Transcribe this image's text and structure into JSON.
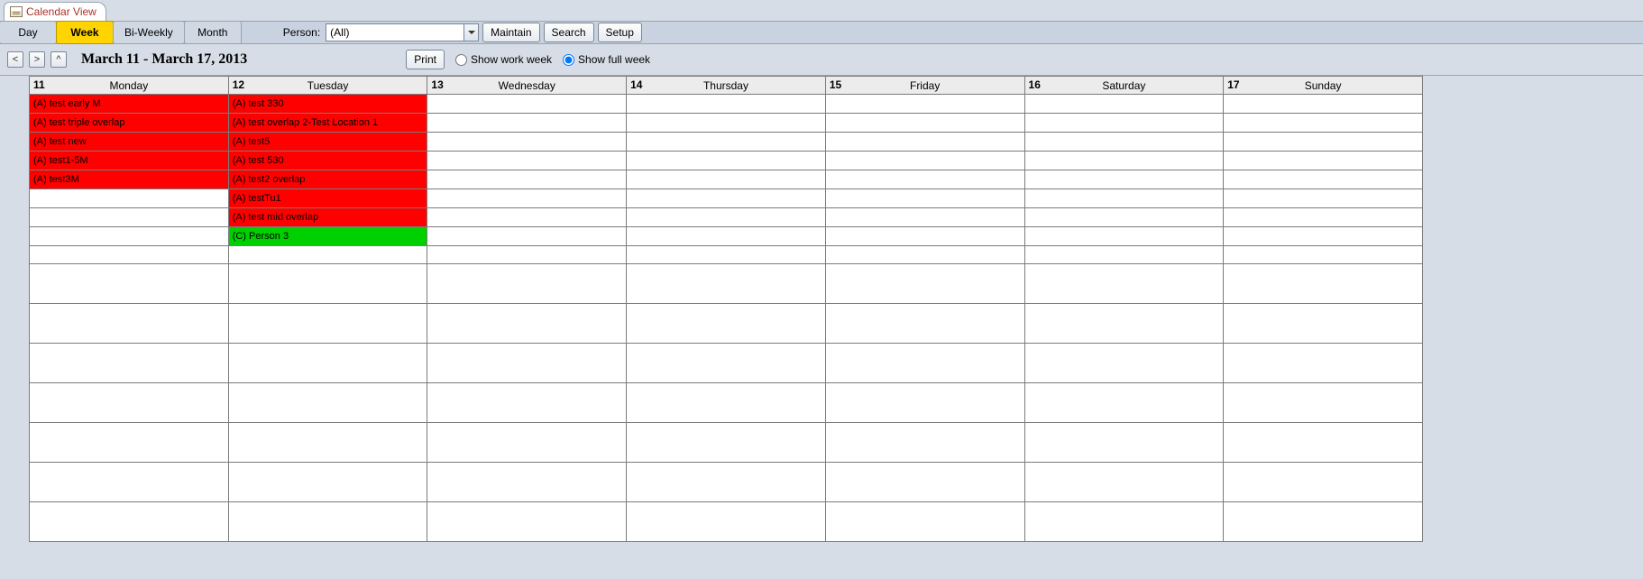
{
  "tab": {
    "label": "Calendar View"
  },
  "views": {
    "day": "Day",
    "week": "Week",
    "biweekly": "Bi-Weekly",
    "month": "Month",
    "active": "week"
  },
  "person": {
    "label": "Person:",
    "value": "(All)"
  },
  "buttons": {
    "maintain": "Maintain",
    "search": "Search",
    "setup": "Setup",
    "print": "Print"
  },
  "nav": {
    "prev": "<",
    "next": ">",
    "up": "^"
  },
  "date_range": "March 11 - March 17, 2013",
  "week_mode": {
    "work": "Show work week",
    "full": "Show full week",
    "selected": "full"
  },
  "days": [
    {
      "num": "11",
      "name": "Monday"
    },
    {
      "num": "12",
      "name": "Tuesday"
    },
    {
      "num": "13",
      "name": "Wednesday"
    },
    {
      "num": "14",
      "name": "Thursday"
    },
    {
      "num": "15",
      "name": "Friday"
    },
    {
      "num": "16",
      "name": "Saturday"
    },
    {
      "num": "17",
      "name": "Sunday"
    }
  ],
  "events": {
    "mon": [
      {
        "label": "(A) test early M",
        "color": "red"
      },
      {
        "label": "(A) test triple overlap",
        "color": "red"
      },
      {
        "label": "(A) test new",
        "color": "red"
      },
      {
        "label": "(A) test1-5M",
        "color": "red"
      },
      {
        "label": "(A) test3M",
        "color": "red"
      }
    ],
    "tue": [
      {
        "label": "(A) test 330",
        "color": "red"
      },
      {
        "label": "(A) test overlap 2-Test Location 1",
        "color": "red"
      },
      {
        "label": "(A) test5",
        "color": "red"
      },
      {
        "label": "(A) test 530",
        "color": "red"
      },
      {
        "label": "(A) test2 overlap",
        "color": "red"
      },
      {
        "label": "(A) testTu1",
        "color": "red"
      },
      {
        "label": "(A) test mid overlap",
        "color": "red"
      },
      {
        "label": "(C) Person 3",
        "color": "green"
      }
    ]
  },
  "colors": {
    "red": "#ff0000",
    "green": "#00d000",
    "accent_yellow": "#ffd400"
  }
}
